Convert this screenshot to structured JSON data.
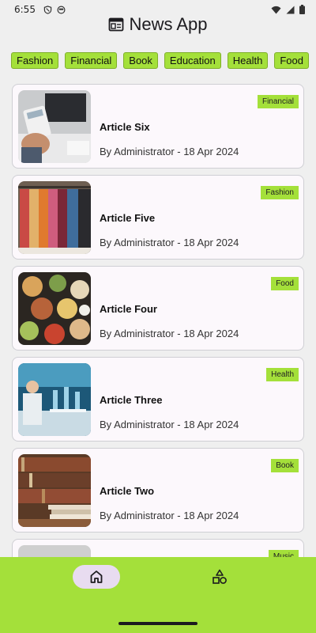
{
  "status_bar": {
    "time": "6:55"
  },
  "app": {
    "title": "News App"
  },
  "categories": [
    "Fashion",
    "Financial",
    "Book",
    "Education",
    "Health",
    "Food"
  ],
  "articles": [
    {
      "title": "Article Six",
      "meta": "By Administrator - 18 Apr 2024",
      "category": "Financial"
    },
    {
      "title": "Article Five",
      "meta": "By Administrator - 18 Apr 2024",
      "category": "Fashion"
    },
    {
      "title": "Article Four",
      "meta": "By Administrator - 18 Apr 2024",
      "category": "Food"
    },
    {
      "title": "Article Three",
      "meta": "By Administrator - 18 Apr 2024",
      "category": "Health"
    },
    {
      "title": "Article Two",
      "meta": "By Administrator - 18 Apr 2024",
      "category": "Book"
    },
    {
      "title": "",
      "meta": "",
      "category": "Music"
    }
  ],
  "nav": {
    "items": [
      {
        "icon": "home-icon",
        "selected": true
      },
      {
        "icon": "categories-icon",
        "selected": false
      }
    ]
  },
  "colors": {
    "accent": "#a4e03a",
    "nav_selected": "#e8dcf0",
    "card_bg": "#fcf8fc"
  }
}
